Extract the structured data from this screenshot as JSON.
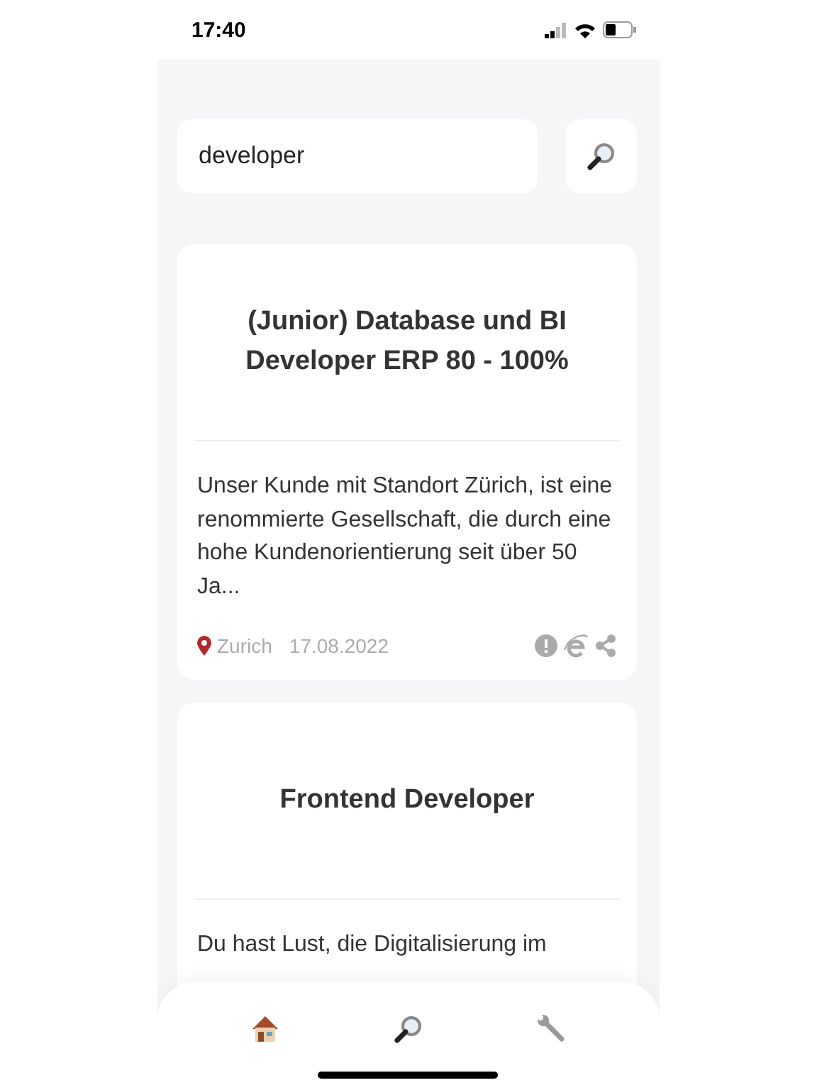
{
  "status_bar": {
    "time": "17:40"
  },
  "search": {
    "value": "developer"
  },
  "jobs": [
    {
      "title": "(Junior) Database und BI Developer ERP 80 - 100%",
      "description": "Unser Kunde mit Standort Zürich, ist eine renommierte Gesellschaft, die durch eine hohe Kundenorientierung seit über 50 Ja...",
      "location": "Zurich",
      "date": "17.08.2022"
    },
    {
      "title": "Frontend Developer",
      "description": "Du hast Lust, die Digitalisierung im"
    }
  ],
  "nav": {
    "items": [
      {
        "kind": "home"
      },
      {
        "kind": "search"
      },
      {
        "kind": "settings"
      }
    ]
  }
}
